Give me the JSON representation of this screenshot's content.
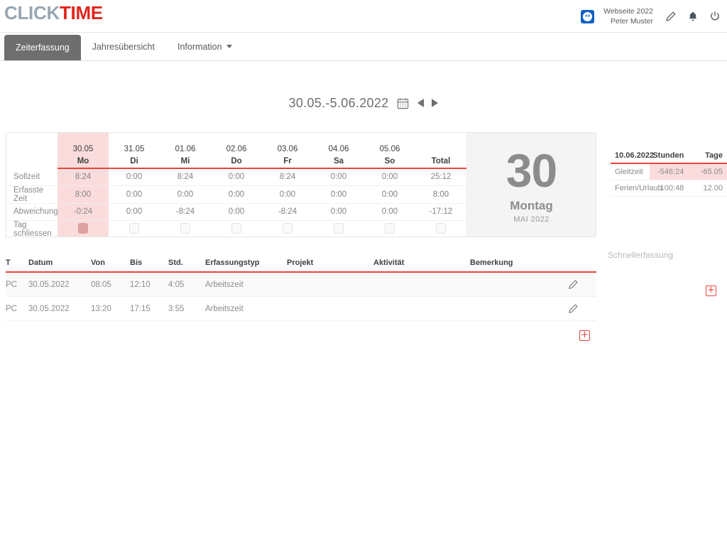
{
  "app": {
    "logo_click": "CLICK",
    "logo_time": "TIME"
  },
  "header": {
    "teamviewer_icon": "teamviewer-icon",
    "company": "Webseite 2022",
    "user": "Peter Muster",
    "icons": [
      {
        "name": "edit-pencil-icon",
        "label": "Bearbeiten"
      },
      {
        "name": "bell-icon",
        "label": "Benachrichtigungen"
      },
      {
        "name": "power-icon",
        "label": "Abmelden"
      }
    ]
  },
  "nav": {
    "tabs": [
      {
        "label": "Zeiterfassung",
        "active": true
      },
      {
        "label": "Jahresübersicht",
        "active": false
      },
      {
        "label": "Information",
        "active": false,
        "dropdown": true
      }
    ]
  },
  "datenav": {
    "range": "30.05.-5.06.2022",
    "calendar_icon": "calendar-icon",
    "prev_icon": "arrow-left-icon",
    "next_icon": "arrow-right-icon"
  },
  "week": {
    "days": [
      {
        "date": "30.05",
        "weekday": "Mo",
        "highlight": true
      },
      {
        "date": "31.05",
        "weekday": "Di",
        "highlight": false
      },
      {
        "date": "01.06",
        "weekday": "Mi",
        "highlight": false
      },
      {
        "date": "02.06",
        "weekday": "Do",
        "highlight": false
      },
      {
        "date": "03.06",
        "weekday": "Fr",
        "highlight": false
      },
      {
        "date": "04.06",
        "weekday": "Sa",
        "highlight": false
      },
      {
        "date": "05.06",
        "weekday": "So",
        "highlight": false
      }
    ],
    "total_header": "Total",
    "rows": [
      {
        "label": "Sollzeit",
        "values": [
          "8:24",
          "0:00",
          "8:24",
          "0:00",
          "8:24",
          "0:00",
          "0:00"
        ],
        "total": "25:12"
      },
      {
        "label": "Erfasste Zeit",
        "values": [
          "8:00",
          "0:00",
          "0:00",
          "0:00",
          "0:00",
          "0:00",
          "0:00"
        ],
        "total": "8:00"
      },
      {
        "label": "Abweichung",
        "values": [
          "-0:24",
          "0:00",
          "-8:24",
          "0:00",
          "-8:24",
          "0:00",
          "0:00"
        ],
        "total": "-17:12"
      }
    ],
    "close_row_label": "Tag schliessen",
    "close_checked": [
      true,
      false,
      false,
      false,
      false,
      false,
      false
    ],
    "close_total_checked": false
  },
  "bigday": {
    "number": "30",
    "dayname": "Montag",
    "monthyear": "MAI 2022"
  },
  "balance": {
    "headers": [
      "10.06.2022",
      "Stunden",
      "Tage"
    ],
    "rows": [
      {
        "label": "Gleitzeit",
        "stunden": "-546:24",
        "tage": "-65.05",
        "highlight": true
      },
      {
        "label": "Ferien/Urlaub",
        "stunden": "100:48",
        "tage": "12.00",
        "highlight": false
      }
    ]
  },
  "quick": {
    "title": "Schnellerfassung",
    "add_label": "+"
  },
  "entries": {
    "headers": [
      "T",
      "Datum",
      "Von",
      "Bis",
      "Std.",
      "Erfassungstyp",
      "Projekt",
      "Aktivität",
      "Bemerkung"
    ],
    "rows": [
      {
        "t": "PC",
        "datum": "30.05.2022",
        "von": "08:05",
        "bis": "12:10",
        "std": "4:05",
        "typ": "Arbeitszeit",
        "projekt": "",
        "aktivitaet": "",
        "bemerkung": "",
        "edit_icon": "edit-pencil-icon"
      },
      {
        "t": "PC",
        "datum": "30.05.2022",
        "von": "13:20",
        "bis": "17:15",
        "std": "3:55",
        "typ": "Arbeitszeit",
        "projekt": "",
        "aktivitaet": "",
        "bemerkung": "",
        "edit_icon": "edit-pencil-icon"
      }
    ],
    "add_label": "+"
  },
  "colors": {
    "brand_red": "#e1251b",
    "accent_line": "#e8453c",
    "highlight_pink": "#fbdcdc",
    "logo_gray": "#97a6b2",
    "tab_active_bg": "#6e6e6e"
  }
}
